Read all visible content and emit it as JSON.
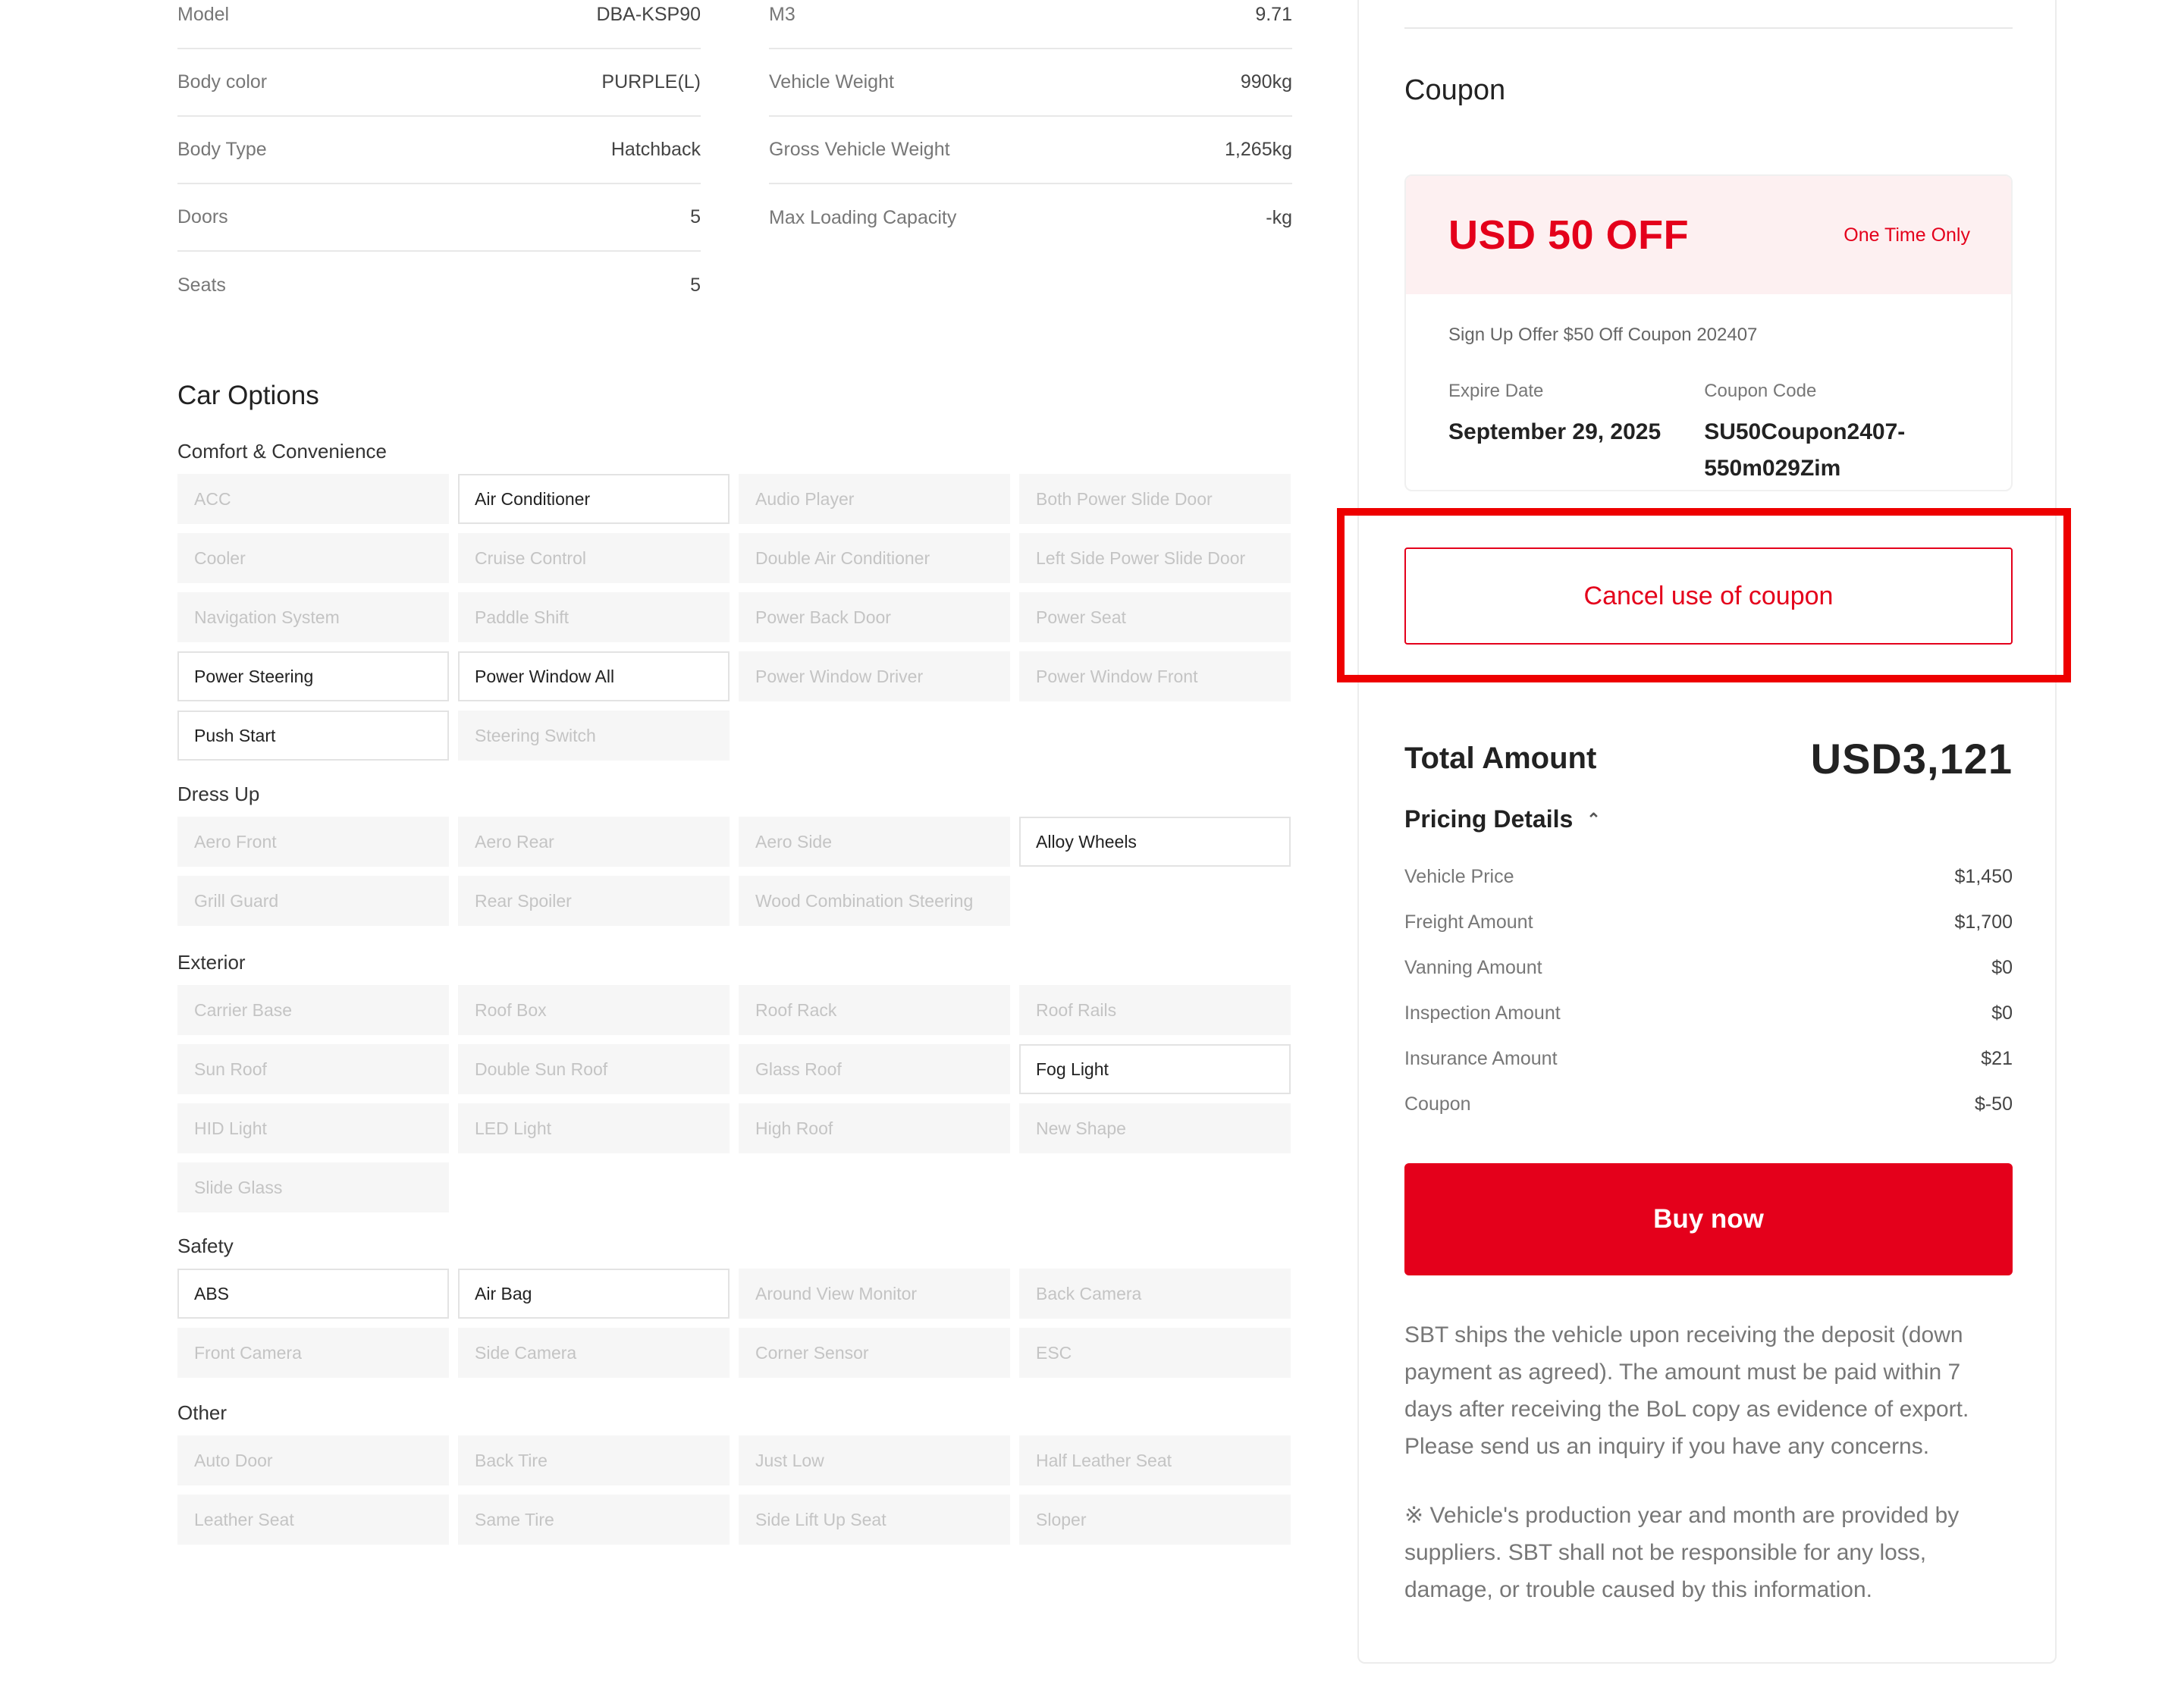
{
  "specs": {
    "left": [
      {
        "label": "Model",
        "value": "DBA-KSP90"
      },
      {
        "label": "Body color",
        "value": "PURPLE(L)"
      },
      {
        "label": "Body Type",
        "value": "Hatchback"
      },
      {
        "label": "Doors",
        "value": "5"
      },
      {
        "label": "Seats",
        "value": "5"
      }
    ],
    "right": [
      {
        "label": "M3",
        "value": "9.71"
      },
      {
        "label": "Vehicle Weight",
        "value": "990kg"
      },
      {
        "label": "Gross Vehicle Weight",
        "value": "1,265kg"
      },
      {
        "label": "Max Loading Capacity",
        "value": "-kg"
      }
    ]
  },
  "options": {
    "title": "Car Options",
    "categories": [
      {
        "name": "Comfort & Convenience",
        "items": [
          {
            "label": "ACC",
            "on": false
          },
          {
            "label": "Air Conditioner",
            "on": true
          },
          {
            "label": "Audio Player",
            "on": false
          },
          {
            "label": "Both Power Slide Door",
            "on": false
          },
          {
            "label": "Cooler",
            "on": false
          },
          {
            "label": "Cruise Control",
            "on": false
          },
          {
            "label": "Double Air Conditioner",
            "on": false
          },
          {
            "label": "Left Side Power Slide Door",
            "on": false
          },
          {
            "label": "Navigation System",
            "on": false
          },
          {
            "label": "Paddle Shift",
            "on": false
          },
          {
            "label": "Power Back Door",
            "on": false
          },
          {
            "label": "Power Seat",
            "on": false
          },
          {
            "label": "Power Steering",
            "on": true
          },
          {
            "label": "Power Window All",
            "on": true
          },
          {
            "label": "Power Window Driver",
            "on": false
          },
          {
            "label": "Power Window Front",
            "on": false
          },
          {
            "label": "Push Start",
            "on": true
          },
          {
            "label": "Steering Switch",
            "on": false
          }
        ]
      },
      {
        "name": "Dress Up",
        "items": [
          {
            "label": "Aero Front",
            "on": false
          },
          {
            "label": "Aero Rear",
            "on": false
          },
          {
            "label": "Aero Side",
            "on": false
          },
          {
            "label": "Alloy Wheels",
            "on": true
          },
          {
            "label": "Grill Guard",
            "on": false
          },
          {
            "label": "Rear Spoiler",
            "on": false
          },
          {
            "label": "Wood Combination Steering",
            "on": false
          }
        ]
      },
      {
        "name": "Exterior",
        "items": [
          {
            "label": "Carrier Base",
            "on": false
          },
          {
            "label": "Roof Box",
            "on": false
          },
          {
            "label": "Roof Rack",
            "on": false
          },
          {
            "label": "Roof Rails",
            "on": false
          },
          {
            "label": "Sun Roof",
            "on": false
          },
          {
            "label": "Double Sun Roof",
            "on": false
          },
          {
            "label": "Glass Roof",
            "on": false
          },
          {
            "label": "Fog Light",
            "on": true
          },
          {
            "label": "HID Light",
            "on": false
          },
          {
            "label": "LED Light",
            "on": false
          },
          {
            "label": "High Roof",
            "on": false
          },
          {
            "label": "New Shape",
            "on": false
          },
          {
            "label": "Slide Glass",
            "on": false
          }
        ]
      },
      {
        "name": "Safety",
        "items": [
          {
            "label": "ABS",
            "on": true
          },
          {
            "label": "Air Bag",
            "on": true
          },
          {
            "label": "Around View Monitor",
            "on": false
          },
          {
            "label": "Back Camera",
            "on": false
          },
          {
            "label": "Front Camera",
            "on": false
          },
          {
            "label": "Side Camera",
            "on": false
          },
          {
            "label": "Corner Sensor",
            "on": false
          },
          {
            "label": "ESC",
            "on": false
          }
        ]
      },
      {
        "name": "Other",
        "items": [
          {
            "label": "Auto Door",
            "on": false
          },
          {
            "label": "Back Tire",
            "on": false
          },
          {
            "label": "Just Low",
            "on": false
          },
          {
            "label": "Half Leather Seat",
            "on": false
          },
          {
            "label": "Leather Seat",
            "on": false
          },
          {
            "label": "Same Tire",
            "on": false
          },
          {
            "label": "Side Lift Up Seat",
            "on": false
          },
          {
            "label": "Sloper",
            "on": false
          }
        ]
      }
    ]
  },
  "coupon": {
    "title": "Coupon",
    "amount": "USD 50 OFF",
    "frequency": "One Time Only",
    "description": "Sign Up Offer $50 Off Coupon 202407",
    "expire_label": "Expire Date",
    "expire_value": "September 29, 2025",
    "code_label": "Coupon Code",
    "code_value": "SU50Coupon2407-550m029Zim",
    "cancel_label": "Cancel use of coupon"
  },
  "totals": {
    "label": "Total Amount",
    "value": "USD3,121",
    "pricing_title": "Pricing Details",
    "rows": [
      {
        "label": "Vehicle Price",
        "value": "$1,450"
      },
      {
        "label": "Freight Amount",
        "value": "$1,700"
      },
      {
        "label": "Vanning Amount",
        "value": "$0"
      },
      {
        "label": "Inspection Amount",
        "value": "$0"
      },
      {
        "label": "Insurance Amount",
        "value": "$21"
      },
      {
        "label": "Coupon",
        "value": "$-50"
      }
    ]
  },
  "buy_label": "Buy now",
  "notes": {
    "deposit": "SBT ships the vehicle upon receiving the deposit (down payment as agreed). The amount must be paid within 7 days after receiving the BoL copy as evidence of export. Please send us an inquiry if you have any concerns.",
    "production": "※ Vehicle's production year and month are provided by suppliers. SBT shall not be responsible for any loss, damage, or trouble caused by this information."
  },
  "colors": {
    "accent": "#e4001b",
    "highlight": "#ee0000",
    "coupon_bg": "#fdf0f1"
  }
}
